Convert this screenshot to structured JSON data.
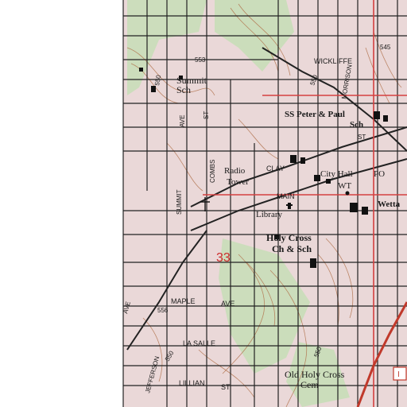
{
  "map": {
    "colors": {
      "background": "#ffffff",
      "urban_tint": "#e8d6d6",
      "contour": "#b0704a",
      "road": "#222222",
      "highway": "#c0392b",
      "section_line": "#d44040",
      "text": "#1a1a1a",
      "section_text": "#cc2a2a",
      "tree": "#2e7d32"
    },
    "streets": {
      "wickliffe": "WICKLIFFE",
      "clay": "CLAY",
      "main": "MAIN",
      "maple": "MAPLE",
      "maple_suffix": "AVE",
      "la_salle": "LA SALLE",
      "lillian": "LILLIAN",
      "lillian_suffix": "ST",
      "summit": "SUMMIT",
      "summit_ave": "AVE",
      "combs": "COMBS",
      "combs_st": "ST",
      "jefferson": "JEFFERSON",
      "morrison": "MORRISON",
      "ave_west": "AVE",
      "st_east": "ST"
    },
    "places": {
      "summit_sch_1": "Summit",
      "summit_sch_2": "Sch",
      "ss_peter_paul": "SS Peter & Paul",
      "ss_peter_paul_sch": "Sch",
      "radio_tower_1": "Radio",
      "radio_tower_2": "Tower",
      "city_hall": "City Hall",
      "po": "PO",
      "wt": "WT",
      "library": "Library",
      "holy_cross_1": "Holy Cross",
      "holy_cross_2": "Ch & Sch",
      "old_holy_cross_1": "Old Holy Cross",
      "old_holy_cross_2": "Cem",
      "wetta": "Wetta"
    },
    "elevations": {
      "e553": "553",
      "e545": "545",
      "e550_a": "550",
      "e550_b": "550",
      "e550_c": "550",
      "e556": "556",
      "e550_d": "550"
    },
    "section": "33",
    "highway_shield": "I"
  }
}
